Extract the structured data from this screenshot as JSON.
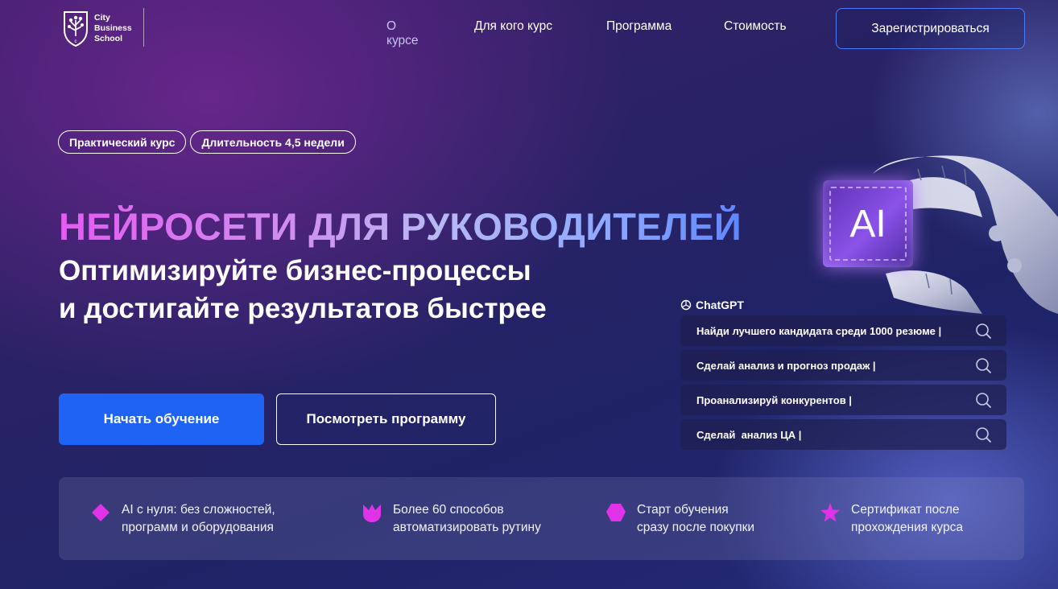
{
  "header": {
    "logo_lines": [
      "City",
      "Business",
      "School"
    ],
    "nav": [
      {
        "label": "О курсе",
        "active": true
      },
      {
        "label": "Для кого курс",
        "active": false
      },
      {
        "label": "Программа",
        "active": false
      },
      {
        "label": "Стоимость",
        "active": false
      }
    ],
    "register_label": "Зарегистрироваться"
  },
  "hero": {
    "tags": [
      "Практический курс",
      "Длительность 4,5 недели"
    ],
    "headline": "НЕЙРОСЕТИ ДЛЯ РУКОВОДИТЕЛЕЙ",
    "subheadline_line1": "Оптимизируйте бизнес-процессы",
    "subheadline_line2": "и достигайте результатов быстрее",
    "start_button": "Начать обучение",
    "program_button": "Посмотреть программу",
    "ai_chip_label": "AI"
  },
  "chatgpt": {
    "label": "ChatGPT",
    "prompts": [
      "Найди лучшего кандидата среди 1000 резюме |",
      "Сделай анализ и прогноз продаж |",
      "Проанализируй конкурентов |",
      "Сделай  анализ ЦА |"
    ]
  },
  "features": [
    {
      "icon": "diamond-icon",
      "text": "AI с нуля: без сложностей,\nпрограмм и оборудования"
    },
    {
      "icon": "crown-icon",
      "text": "Более 60 способов\nавтоматизировать рутину"
    },
    {
      "icon": "pentagon-icon",
      "text": "Старт обучения\nсразу после покупки"
    },
    {
      "icon": "star-icon",
      "text": "Сертификат после\nпрохождения курса"
    }
  ],
  "colors": {
    "accent_blue": "#1f63f5",
    "feature_icon": "#e033e8",
    "headline_gradient_start": "#e45bf0",
    "headline_gradient_end": "#5f86ff"
  }
}
